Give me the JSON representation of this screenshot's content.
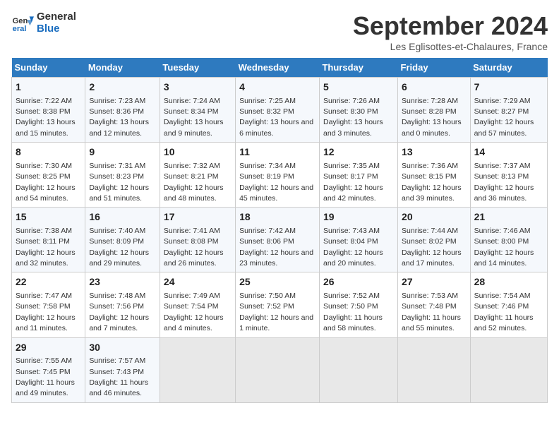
{
  "logo": {
    "line1": "General",
    "line2": "Blue"
  },
  "title": "September 2024",
  "subtitle": "Les Eglisottes-et-Chalaures, France",
  "days_header": [
    "Sunday",
    "Monday",
    "Tuesday",
    "Wednesday",
    "Thursday",
    "Friday",
    "Saturday"
  ],
  "weeks": [
    [
      {
        "day": "1",
        "sunrise": "Sunrise: 7:22 AM",
        "sunset": "Sunset: 8:38 PM",
        "daylight": "Daylight: 13 hours and 15 minutes."
      },
      {
        "day": "2",
        "sunrise": "Sunrise: 7:23 AM",
        "sunset": "Sunset: 8:36 PM",
        "daylight": "Daylight: 13 hours and 12 minutes."
      },
      {
        "day": "3",
        "sunrise": "Sunrise: 7:24 AM",
        "sunset": "Sunset: 8:34 PM",
        "daylight": "Daylight: 13 hours and 9 minutes."
      },
      {
        "day": "4",
        "sunrise": "Sunrise: 7:25 AM",
        "sunset": "Sunset: 8:32 PM",
        "daylight": "Daylight: 13 hours and 6 minutes."
      },
      {
        "day": "5",
        "sunrise": "Sunrise: 7:26 AM",
        "sunset": "Sunset: 8:30 PM",
        "daylight": "Daylight: 13 hours and 3 minutes."
      },
      {
        "day": "6",
        "sunrise": "Sunrise: 7:28 AM",
        "sunset": "Sunset: 8:28 PM",
        "daylight": "Daylight: 13 hours and 0 minutes."
      },
      {
        "day": "7",
        "sunrise": "Sunrise: 7:29 AM",
        "sunset": "Sunset: 8:27 PM",
        "daylight": "Daylight: 12 hours and 57 minutes."
      }
    ],
    [
      {
        "day": "8",
        "sunrise": "Sunrise: 7:30 AM",
        "sunset": "Sunset: 8:25 PM",
        "daylight": "Daylight: 12 hours and 54 minutes."
      },
      {
        "day": "9",
        "sunrise": "Sunrise: 7:31 AM",
        "sunset": "Sunset: 8:23 PM",
        "daylight": "Daylight: 12 hours and 51 minutes."
      },
      {
        "day": "10",
        "sunrise": "Sunrise: 7:32 AM",
        "sunset": "Sunset: 8:21 PM",
        "daylight": "Daylight: 12 hours and 48 minutes."
      },
      {
        "day": "11",
        "sunrise": "Sunrise: 7:34 AM",
        "sunset": "Sunset: 8:19 PM",
        "daylight": "Daylight: 12 hours and 45 minutes."
      },
      {
        "day": "12",
        "sunrise": "Sunrise: 7:35 AM",
        "sunset": "Sunset: 8:17 PM",
        "daylight": "Daylight: 12 hours and 42 minutes."
      },
      {
        "day": "13",
        "sunrise": "Sunrise: 7:36 AM",
        "sunset": "Sunset: 8:15 PM",
        "daylight": "Daylight: 12 hours and 39 minutes."
      },
      {
        "day": "14",
        "sunrise": "Sunrise: 7:37 AM",
        "sunset": "Sunset: 8:13 PM",
        "daylight": "Daylight: 12 hours and 36 minutes."
      }
    ],
    [
      {
        "day": "15",
        "sunrise": "Sunrise: 7:38 AM",
        "sunset": "Sunset: 8:11 PM",
        "daylight": "Daylight: 12 hours and 32 minutes."
      },
      {
        "day": "16",
        "sunrise": "Sunrise: 7:40 AM",
        "sunset": "Sunset: 8:09 PM",
        "daylight": "Daylight: 12 hours and 29 minutes."
      },
      {
        "day": "17",
        "sunrise": "Sunrise: 7:41 AM",
        "sunset": "Sunset: 8:08 PM",
        "daylight": "Daylight: 12 hours and 26 minutes."
      },
      {
        "day": "18",
        "sunrise": "Sunrise: 7:42 AM",
        "sunset": "Sunset: 8:06 PM",
        "daylight": "Daylight: 12 hours and 23 minutes."
      },
      {
        "day": "19",
        "sunrise": "Sunrise: 7:43 AM",
        "sunset": "Sunset: 8:04 PM",
        "daylight": "Daylight: 12 hours and 20 minutes."
      },
      {
        "day": "20",
        "sunrise": "Sunrise: 7:44 AM",
        "sunset": "Sunset: 8:02 PM",
        "daylight": "Daylight: 12 hours and 17 minutes."
      },
      {
        "day": "21",
        "sunrise": "Sunrise: 7:46 AM",
        "sunset": "Sunset: 8:00 PM",
        "daylight": "Daylight: 12 hours and 14 minutes."
      }
    ],
    [
      {
        "day": "22",
        "sunrise": "Sunrise: 7:47 AM",
        "sunset": "Sunset: 7:58 PM",
        "daylight": "Daylight: 12 hours and 11 minutes."
      },
      {
        "day": "23",
        "sunrise": "Sunrise: 7:48 AM",
        "sunset": "Sunset: 7:56 PM",
        "daylight": "Daylight: 12 hours and 7 minutes."
      },
      {
        "day": "24",
        "sunrise": "Sunrise: 7:49 AM",
        "sunset": "Sunset: 7:54 PM",
        "daylight": "Daylight: 12 hours and 4 minutes."
      },
      {
        "day": "25",
        "sunrise": "Sunrise: 7:50 AM",
        "sunset": "Sunset: 7:52 PM",
        "daylight": "Daylight: 12 hours and 1 minute."
      },
      {
        "day": "26",
        "sunrise": "Sunrise: 7:52 AM",
        "sunset": "Sunset: 7:50 PM",
        "daylight": "Daylight: 11 hours and 58 minutes."
      },
      {
        "day": "27",
        "sunrise": "Sunrise: 7:53 AM",
        "sunset": "Sunset: 7:48 PM",
        "daylight": "Daylight: 11 hours and 55 minutes."
      },
      {
        "day": "28",
        "sunrise": "Sunrise: 7:54 AM",
        "sunset": "Sunset: 7:46 PM",
        "daylight": "Daylight: 11 hours and 52 minutes."
      }
    ],
    [
      {
        "day": "29",
        "sunrise": "Sunrise: 7:55 AM",
        "sunset": "Sunset: 7:45 PM",
        "daylight": "Daylight: 11 hours and 49 minutes."
      },
      {
        "day": "30",
        "sunrise": "Sunrise: 7:57 AM",
        "sunset": "Sunset: 7:43 PM",
        "daylight": "Daylight: 11 hours and 46 minutes."
      },
      null,
      null,
      null,
      null,
      null
    ]
  ]
}
